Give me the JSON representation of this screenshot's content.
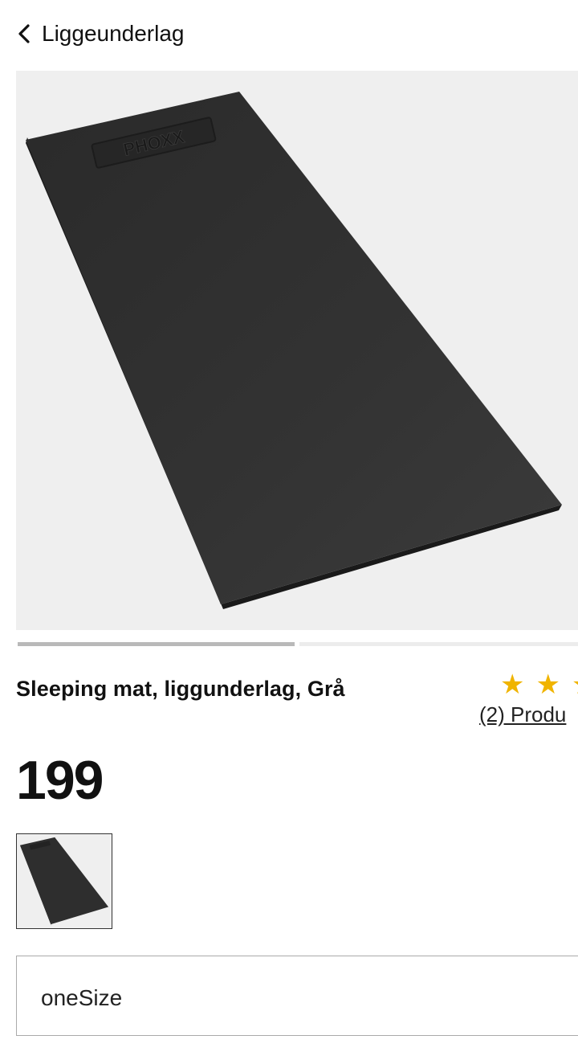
{
  "header": {
    "back_label": "Liggeunderlag"
  },
  "product": {
    "image_brand_text": "PHOXX",
    "title": "Sleeping mat, liggunderlag, Grå",
    "price": "199",
    "rating": {
      "stars": [
        "★",
        "★",
        "★"
      ],
      "review_link": "(2) Produ"
    },
    "gallery": {
      "current_index": 1,
      "total": 2
    },
    "size": {
      "selected": "oneSize"
    }
  },
  "colors": {
    "star": "#f0b400",
    "mat": "#2c2c2c",
    "image_bg": "#efefef"
  }
}
